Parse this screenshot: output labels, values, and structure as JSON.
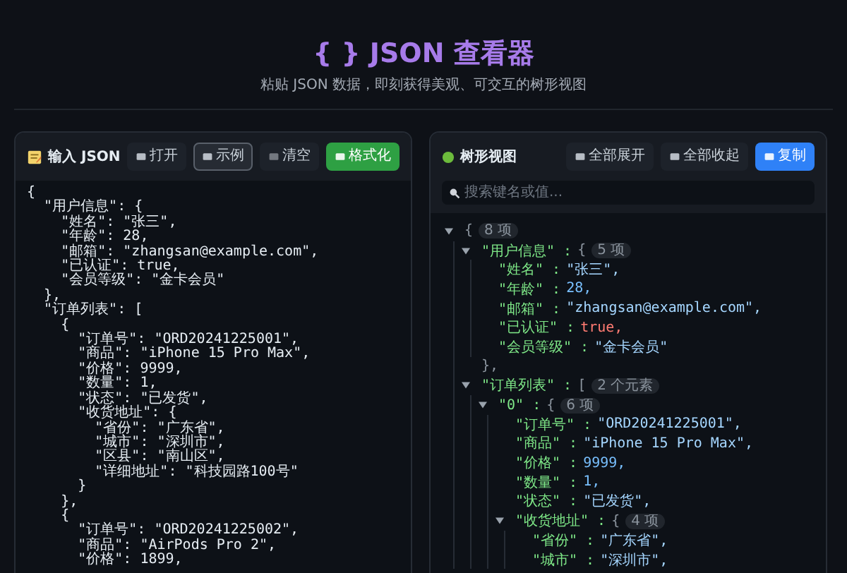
{
  "header": {
    "title": "{ } JSON 查看器",
    "subtitle": "粘贴 JSON 数据，即刻获得美观、可交互的树形视图"
  },
  "input_panel": {
    "title": "输入 JSON",
    "buttons": [
      {
        "label": "打开",
        "kind": "plain",
        "selected": false
      },
      {
        "label": "示例",
        "kind": "plain",
        "selected": true
      },
      {
        "label": "清空",
        "kind": "plain",
        "selected": false
      },
      {
        "label": "格式化",
        "kind": "success",
        "selected": false
      }
    ],
    "code_lines": [
      "{",
      "  \"用户信息\": {",
      "    \"姓名\": \"张三\",",
      "    \"年龄\": 28,",
      "    \"邮箱\": \"zhangsan@example.com\",",
      "    \"已认证\": true,",
      "    \"会员等级\": \"金卡会员\"",
      "  },",
      "  \"订单列表\": [",
      "    {",
      "      \"订单号\": \"ORD20241225001\",",
      "      \"商品\": \"iPhone 15 Pro Max\",",
      "      \"价格\": 9999,",
      "      \"数量\": 1,",
      "      \"状态\": \"已发货\",",
      "      \"收货地址\": {",
      "        \"省份\": \"广东省\",",
      "        \"城市\": \"深圳市\",",
      "        \"区县\": \"南山区\",",
      "        \"详细地址\": \"科技园路100号\"",
      "      }",
      "    },",
      "    {",
      "      \"订单号\": \"ORD20241225002\",",
      "      \"商品\": \"AirPods Pro 2\",",
      "      \"价格\": 1899,"
    ]
  },
  "tree_panel": {
    "title": "树形视图",
    "buttons": [
      {
        "label": "全部展开",
        "kind": "plain",
        "selected": false
      },
      {
        "label": "全部收起",
        "kind": "plain",
        "selected": false
      },
      {
        "label": "复制",
        "kind": "primary",
        "selected": false
      }
    ],
    "search": {
      "placeholder": "搜索键名或值..."
    },
    "root": {
      "open": "{",
      "count": "8 项",
      "expanded": true,
      "children": [
        {
          "key": "\"用户信息\" :",
          "open": "{",
          "count": "5 项",
          "expanded": true,
          "closing": "},",
          "children": [
            {
              "key": "\"姓名\" :",
              "kind": "string",
              "value": "\"张三\","
            },
            {
              "key": "\"年龄\" :",
              "kind": "number",
              "value": "28,"
            },
            {
              "key": "\"邮箱\" :",
              "kind": "string",
              "value": "\"zhangsan@example.com\","
            },
            {
              "key": "\"已认证\" :",
              "kind": "boolean",
              "value": "true,"
            },
            {
              "key": "\"会员等级\" :",
              "kind": "string",
              "value": "\"金卡会员\""
            }
          ]
        },
        {
          "key": "\"订单列表\" :",
          "open": "[",
          "count": "2 个元素",
          "expanded": true,
          "children": [
            {
              "key": "\"0\" :",
              "open": "{",
              "count": "6 项",
              "expanded": true,
              "children": [
                {
                  "key": "\"订单号\" :",
                  "kind": "string",
                  "value": "\"ORD20241225001\","
                },
                {
                  "key": "\"商品\" :",
                  "kind": "string",
                  "value": "\"iPhone 15 Pro Max\","
                },
                {
                  "key": "\"价格\" :",
                  "kind": "number",
                  "value": "9999,"
                },
                {
                  "key": "\"数量\" :",
                  "kind": "number",
                  "value": "1,"
                },
                {
                  "key": "\"状态\" :",
                  "kind": "string",
                  "value": "\"已发货\","
                },
                {
                  "key": "\"收货地址\" :",
                  "open": "{",
                  "count": "4 项",
                  "expanded": true,
                  "children": [
                    {
                      "key": "\"省份\" :",
                      "kind": "string",
                      "value": "\"广东省\","
                    },
                    {
                      "key": "\"城市\" :",
                      "kind": "string",
                      "value": "\"深圳市\","
                    }
                  ]
                }
              ]
            }
          ]
        }
      ]
    }
  }
}
